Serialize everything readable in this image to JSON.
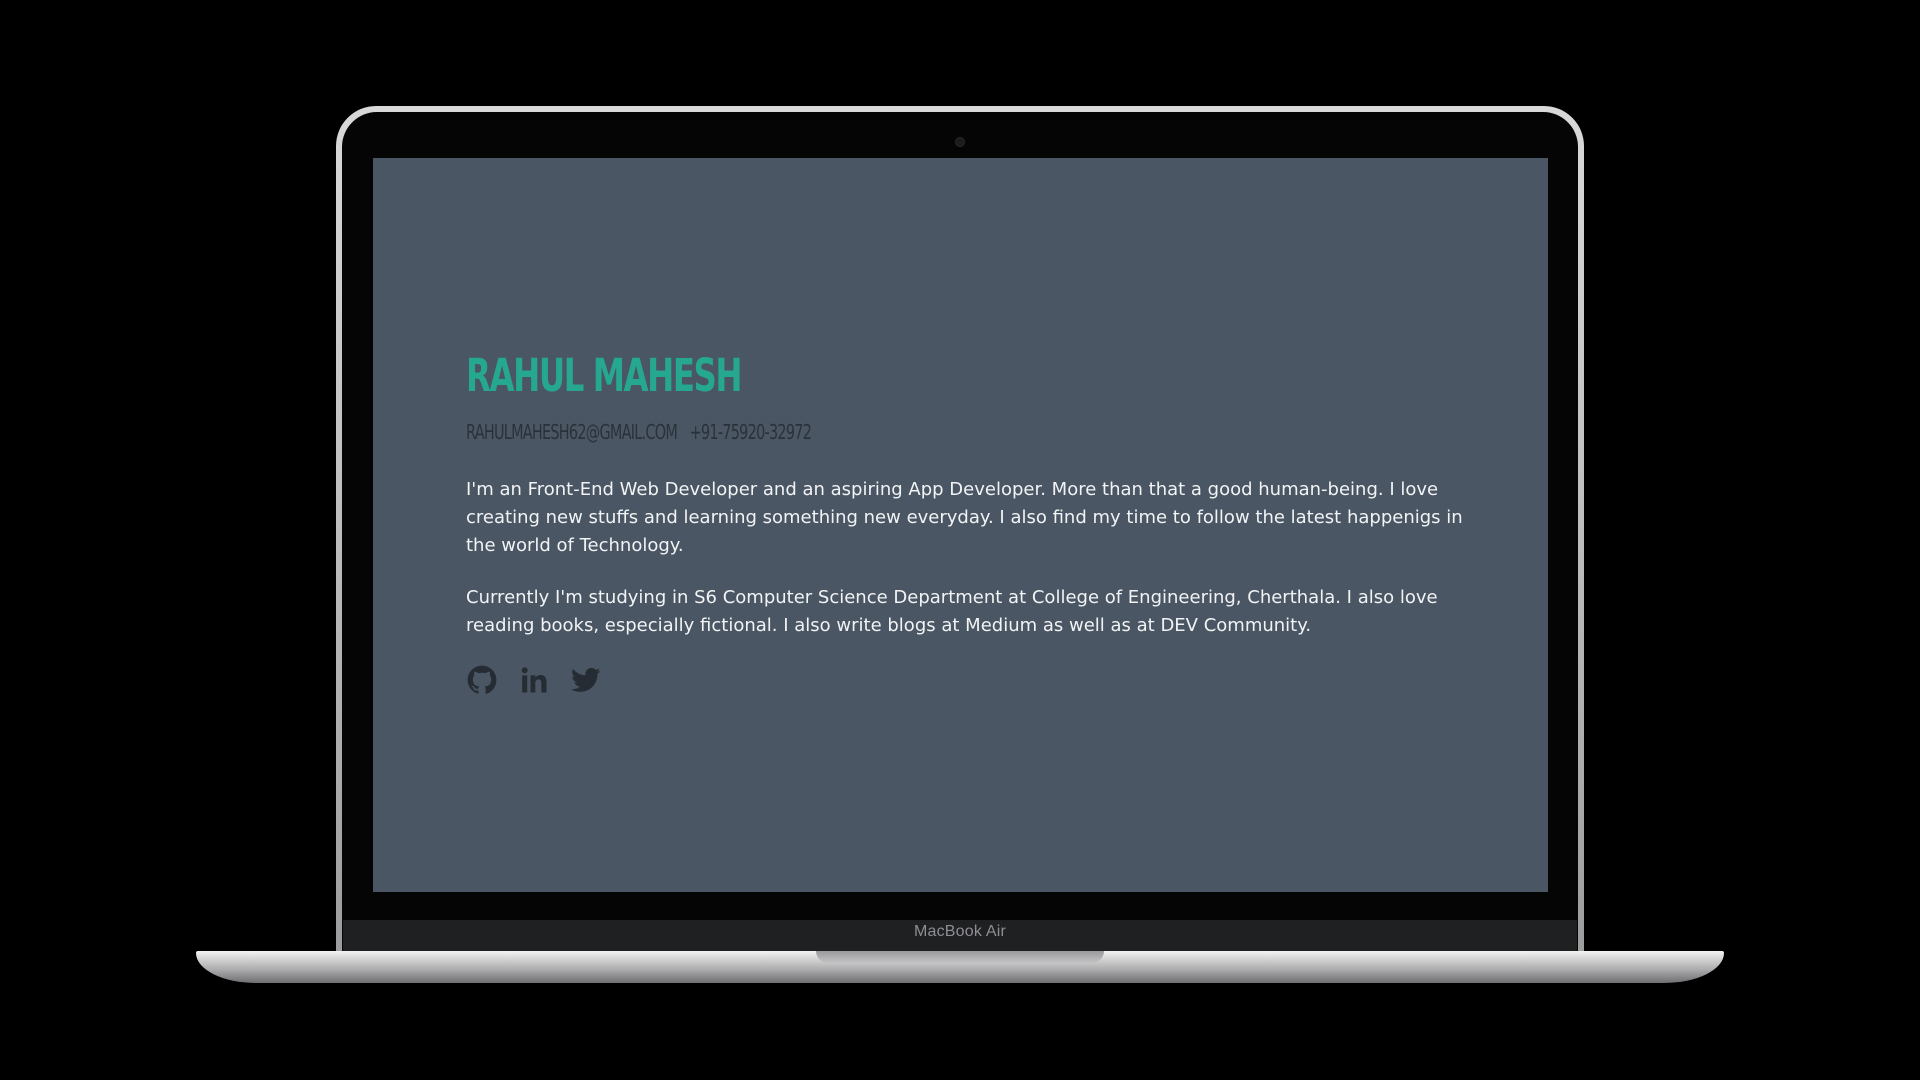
{
  "device": {
    "label": "MacBook Air"
  },
  "profile": {
    "name": "RAHUL MAHESH",
    "email": "RAHULMAHESH62@GMAIL.COM",
    "phone": "+91-75920-32972",
    "bio": [
      "I'm an Front-End Web Developer and an aspiring App Developer. More than that a good human-being. I love creating new stuffs and learning something new everyday. I also find my time to follow the latest happenigs in the world of Technology.",
      "Currently I'm studying in S6 Computer Science Department at College of Engineering, Cherthala. I also love reading books, especially fictional. I also write blogs at Medium as well as at DEV Community."
    ]
  },
  "socials": [
    {
      "icon": "github-icon"
    },
    {
      "icon": "linkedin-icon"
    },
    {
      "icon": "twitter-icon"
    }
  ],
  "colors": {
    "background": "#000000",
    "screen": "#4a5663",
    "accent": "#25a88f",
    "contact_text": "#2a313a",
    "body_text": "#f1f3f5",
    "icon": "#262c33"
  }
}
